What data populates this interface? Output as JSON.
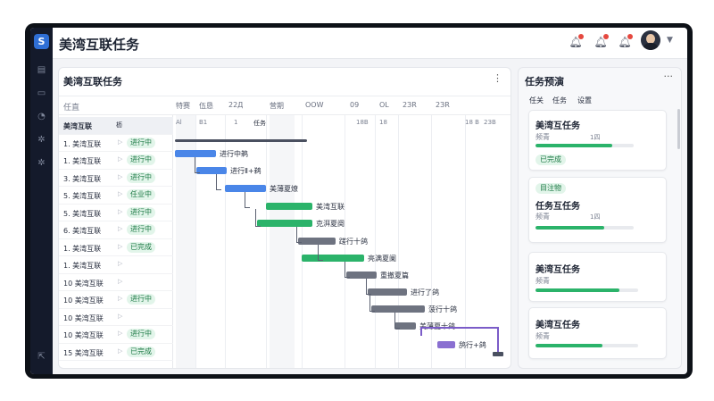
{
  "header": {
    "title": "美湾互联任务"
  },
  "colors": {
    "accent": "#2f6fd6",
    "bar_blue": "#4a86e8",
    "bar_green": "#2bb36a",
    "bar_gray": "#6e7380",
    "bar_purple": "#8a6fd1"
  },
  "gantt": {
    "title": "美湾互联任务",
    "task_col_label": "任直",
    "columns": [
      "特赛",
      "伍恳",
      "22Д",
      "营期",
      "OOW",
      "09",
      "OL",
      "2ЗR",
      "2ЗR"
    ],
    "subheads": [
      "Al",
      "В1",
      "1",
      "任务",
      "18В",
      "18",
      "18 В",
      "2ЗB"
    ],
    "rows": [
      {
        "name": "美湾互联",
        "status": "",
        "sel": true,
        "extra": "枥"
      },
      {
        "name": "1. 美湾互联",
        "status": "进行中"
      },
      {
        "name": "1. 美湾互联",
        "status": "进行中"
      },
      {
        "name": "3. 美湾互联",
        "status": "进行中"
      },
      {
        "name": "5. 美湾互联",
        "status": "任业中"
      },
      {
        "name": "5. 美湾互联",
        "status": "进行中"
      },
      {
        "name": "6. 美湾互联",
        "status": "进行中"
      },
      {
        "name": "1. 美湾互联",
        "status": "已完成"
      },
      {
        "name": "1. 美湾互联",
        "status": ""
      },
      {
        "name": "10 美湾互联",
        "status": ""
      },
      {
        "name": "10 美湾互联",
        "status": "进行中"
      },
      {
        "name": "10 美湾互联",
        "status": ""
      },
      {
        "name": "10 美湾互联",
        "status": "进行中"
      },
      {
        "name": "15 美湾互联",
        "status": "已完成"
      }
    ],
    "bar_labels": [
      "进行中鹈",
      "进行Ⅱ+鹈",
      "美薄夏燎",
      "美湾互联",
      "克湃夏阕",
      "蹉行十鸽",
      "亮满夏阑",
      "重撤夏篇",
      "进行了鸽",
      "菠行十鸽",
      "美薄夏十鸽",
      "鸹行+鸽"
    ]
  },
  "preview": {
    "title": "任务预演",
    "tabs": [
      "任关",
      "任务",
      "设置"
    ],
    "cards": [
      {
        "title": "美湾互任务",
        "label": "频青",
        "value": "1四",
        "progress": 0.78,
        "badge_bottom": "已完成"
      },
      {
        "title": "任务互任务",
        "label": "频青",
        "value": "1四",
        "progress": 0.7,
        "badge_top": "目注物"
      },
      {
        "title": "美湾互任务",
        "label": "频青",
        "progress": 0.82
      },
      {
        "title": "美湾互任务",
        "label": "频青",
        "progress": 0.65
      }
    ]
  }
}
